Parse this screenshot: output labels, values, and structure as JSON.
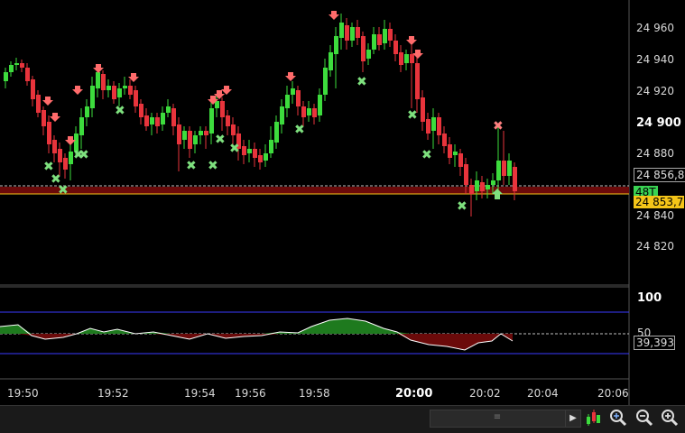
{
  "price_axis": {
    "labels": [
      "24 960",
      "24 940",
      "24 920",
      "24 900",
      "24 880",
      "24 840",
      "24 820"
    ],
    "bold_label": "24 900"
  },
  "price_tags": {
    "last_price": "24 856,8",
    "countdown": "48T",
    "current_price": "24 853,7"
  },
  "oscillator": {
    "level_high": "100",
    "level_mid": "50",
    "current_value": "39,393"
  },
  "time_axis": {
    "labels": [
      "19:50",
      "19:52",
      "19:54",
      "19:56",
      "19:58",
      "20:00",
      "20:02",
      "20:04",
      "20:06"
    ],
    "bold_label": "20:00"
  },
  "colors": {
    "up_candle": "#3ddc3d",
    "down_candle": "#e8343c",
    "background": "#000000",
    "price_line_band": "#6b0a0a",
    "current_price_tag": "#f5c518",
    "countdown_tag": "#39d353"
  },
  "toolbar": {
    "scroll_grip": "≡",
    "scroll_right": "▶",
    "icons": [
      "chart-properties-icon",
      "zoom-fit-icon",
      "zoom-out-icon",
      "zoom-in-icon"
    ]
  }
}
